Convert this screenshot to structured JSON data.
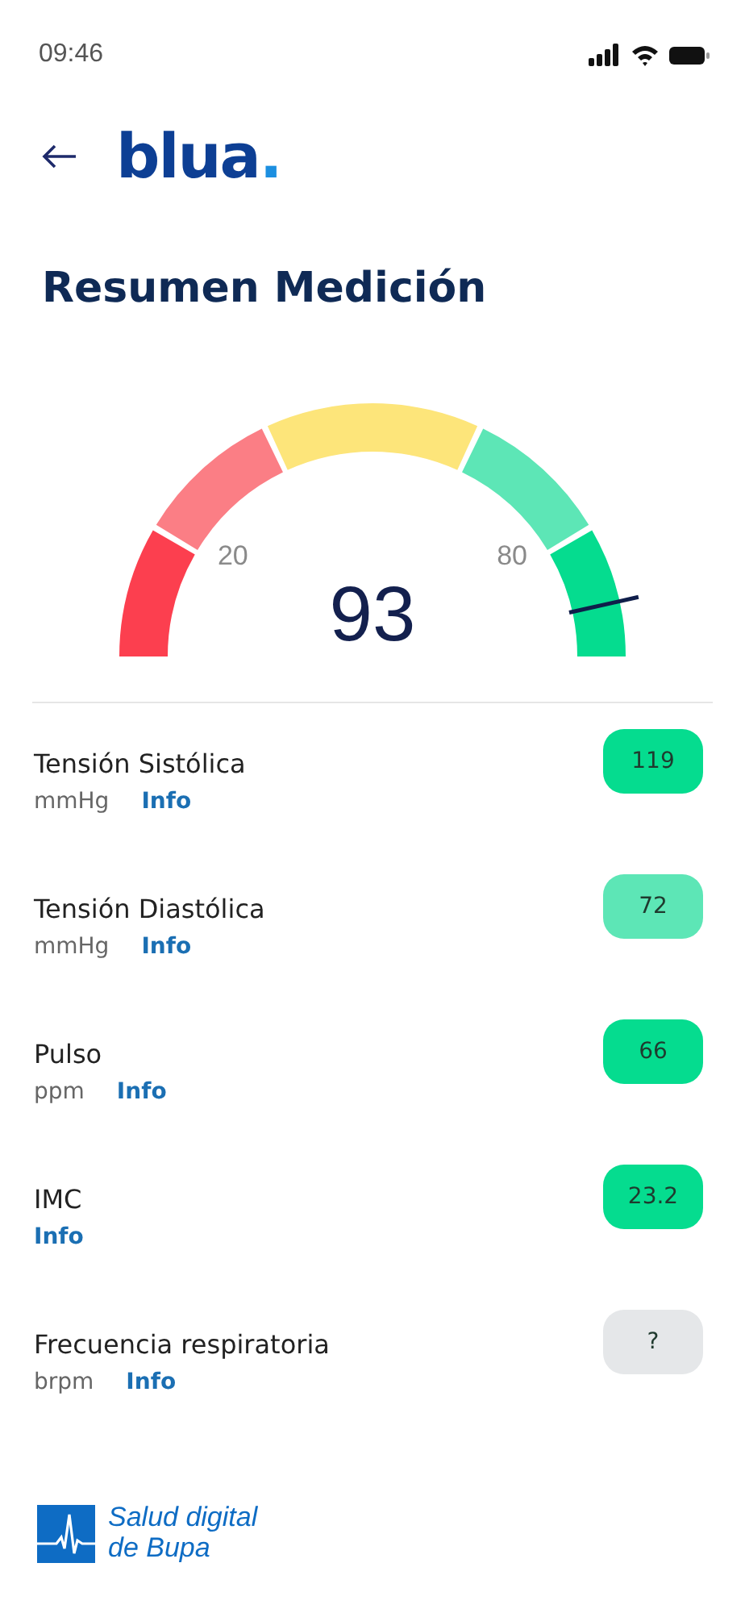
{
  "status_bar": {
    "time": "09:46"
  },
  "header": {
    "logo": "blua",
    "logo_dot": "."
  },
  "title": "Resumen Medición",
  "gauge": {
    "value": "93",
    "ticks": [
      "20",
      "80"
    ],
    "segments": [
      {
        "color": "#fc3f4f"
      },
      {
        "color": "#fb7e85"
      },
      {
        "color": "#fde57a"
      },
      {
        "color": "#5de6b6"
      },
      {
        "color": "#05dc8f"
      }
    ]
  },
  "metrics": [
    {
      "name": "Tensión Sistólica",
      "unit": "mmHg",
      "link": "Info",
      "value": "119",
      "color": "#05dc8f"
    },
    {
      "name": "Tensión Diastólica",
      "unit": "mmHg",
      "link": "Info",
      "value": "72",
      "color": "#5de6b6"
    },
    {
      "name": "Pulso",
      "unit": "ppm",
      "link": "Info",
      "value": "66",
      "color": "#05dc8f"
    },
    {
      "name": "IMC",
      "link": "Info",
      "value": "23.2",
      "color": "#05dc8f"
    },
    {
      "name": "Frecuencia respiratoria",
      "unit": "brpm",
      "link": "Info",
      "value": "?",
      "color": "#e5e7e9"
    }
  ],
  "footer": {
    "brand_line_1": "Salud digital",
    "brand_line_2": "de Bupa"
  }
}
